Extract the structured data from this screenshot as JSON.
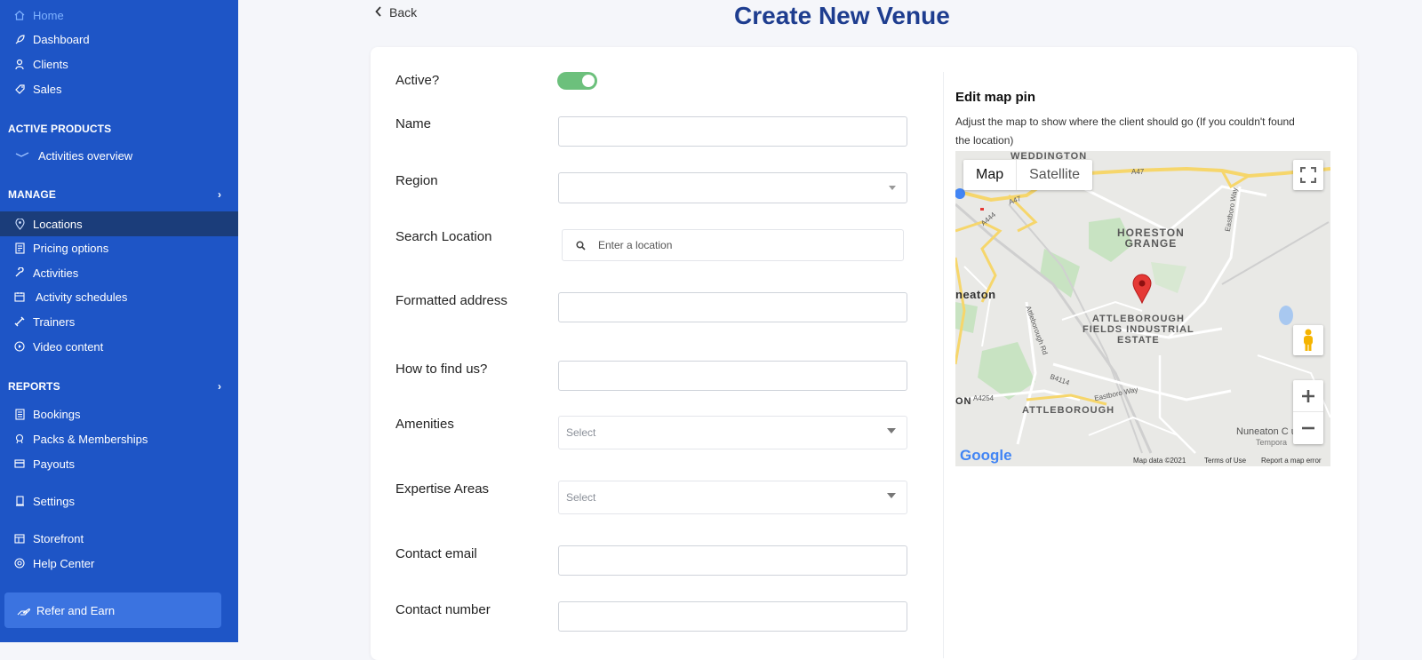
{
  "sidebar": {
    "items": [
      {
        "label": "Home",
        "icon": "home-icon"
      },
      {
        "label": "Dashboard",
        "icon": "rocket-icon"
      },
      {
        "label": "Clients",
        "icon": "users-icon"
      },
      {
        "label": "Sales",
        "icon": "tag-icon"
      }
    ],
    "active_products": {
      "title": "ACTIVE PRODUCTS",
      "items": [
        {
          "label": "Activities overview",
          "icon": "link-icon"
        }
      ]
    },
    "manage": {
      "title": "MANAGE",
      "items": [
        {
          "label": "Locations",
          "icon": "map-pin-icon"
        },
        {
          "label": "Pricing options",
          "icon": "file-icon"
        },
        {
          "label": "Activities",
          "icon": "wrench-icon"
        },
        {
          "label": "Activity schedules",
          "icon": "calendar-icon"
        },
        {
          "label": "Trainers",
          "icon": "dumbbell-icon"
        },
        {
          "label": "Video content",
          "icon": "play-icon"
        }
      ]
    },
    "reports": {
      "title": "REPORTS",
      "items": [
        {
          "label": "Bookings",
          "icon": "document-icon"
        },
        {
          "label": "Packs & Memberships",
          "icon": "badge-icon"
        },
        {
          "label": "Payouts",
          "icon": "card-icon"
        }
      ]
    },
    "settings": {
      "label": "Settings",
      "icon": "gear-icon"
    },
    "storefront": {
      "label": "Storefront",
      "icon": "store-icon"
    },
    "help_center": {
      "label": "Help Center",
      "icon": "help-icon"
    },
    "refer": {
      "label": "Refer and Earn",
      "icon": "hand-icon"
    }
  },
  "header": {
    "back_label": "Back",
    "title": "Create New Venue"
  },
  "form": {
    "active_label": "Active?",
    "active_on": true,
    "name_label": "Name",
    "region_label": "Region",
    "search_label": "Search Location",
    "search_placeholder": "Enter a location",
    "formatted_label": "Formatted address",
    "how_to_find_label": "How to find us?",
    "amenities_label": "Amenities",
    "amenities_placeholder": "Select",
    "expertise_label": "Expertise Areas",
    "expertise_placeholder": "Select",
    "email_label": "Contact email",
    "number_label": "Contact number"
  },
  "map": {
    "title": "Edit map pin",
    "description": "Adjust the map to show where the client should go (If you couldn't found the location)",
    "tab_map": "Map",
    "tab_satellite": "Satellite",
    "labels": {
      "weddington": "WEDDINGTON",
      "horeston": "HORESTON\nGRANGE",
      "nuneaton": "neaton",
      "attleborough_fields": "ATTLEBOROUGH\nFIELDS INDUSTRIAL\nESTATE",
      "attleborough": "ATTLEBOROUGH",
      "on": "ON",
      "nuneaton_club": "Nuneaton C  ub",
      "temporary": "Tempora",
      "a47": "A47",
      "a47b": "A47",
      "a444": "A444",
      "b4114": "B4114",
      "a4254": "A4254",
      "eastboro_way": "Eastboro Way",
      "eastboro_way2": "Eastboro Way",
      "attleborough_rd": "Attleborough Rd"
    },
    "google": "Google",
    "map_data": "Map data ©2021",
    "terms": "Terms of Use",
    "report": "Report a map error",
    "colors": {
      "land": "#e9e9e6",
      "road": "#ffffff",
      "major_road": "#f6d66b",
      "green": "#c8e3c2",
      "water": "#a8c8f0",
      "pin": "#e53935"
    }
  },
  "colors": {
    "sidebar": "#1e55c6",
    "active_item": "#1b3d7a",
    "title": "#1e3d8f",
    "toggle": "#6cc07c",
    "refer": "#3b73e0"
  }
}
